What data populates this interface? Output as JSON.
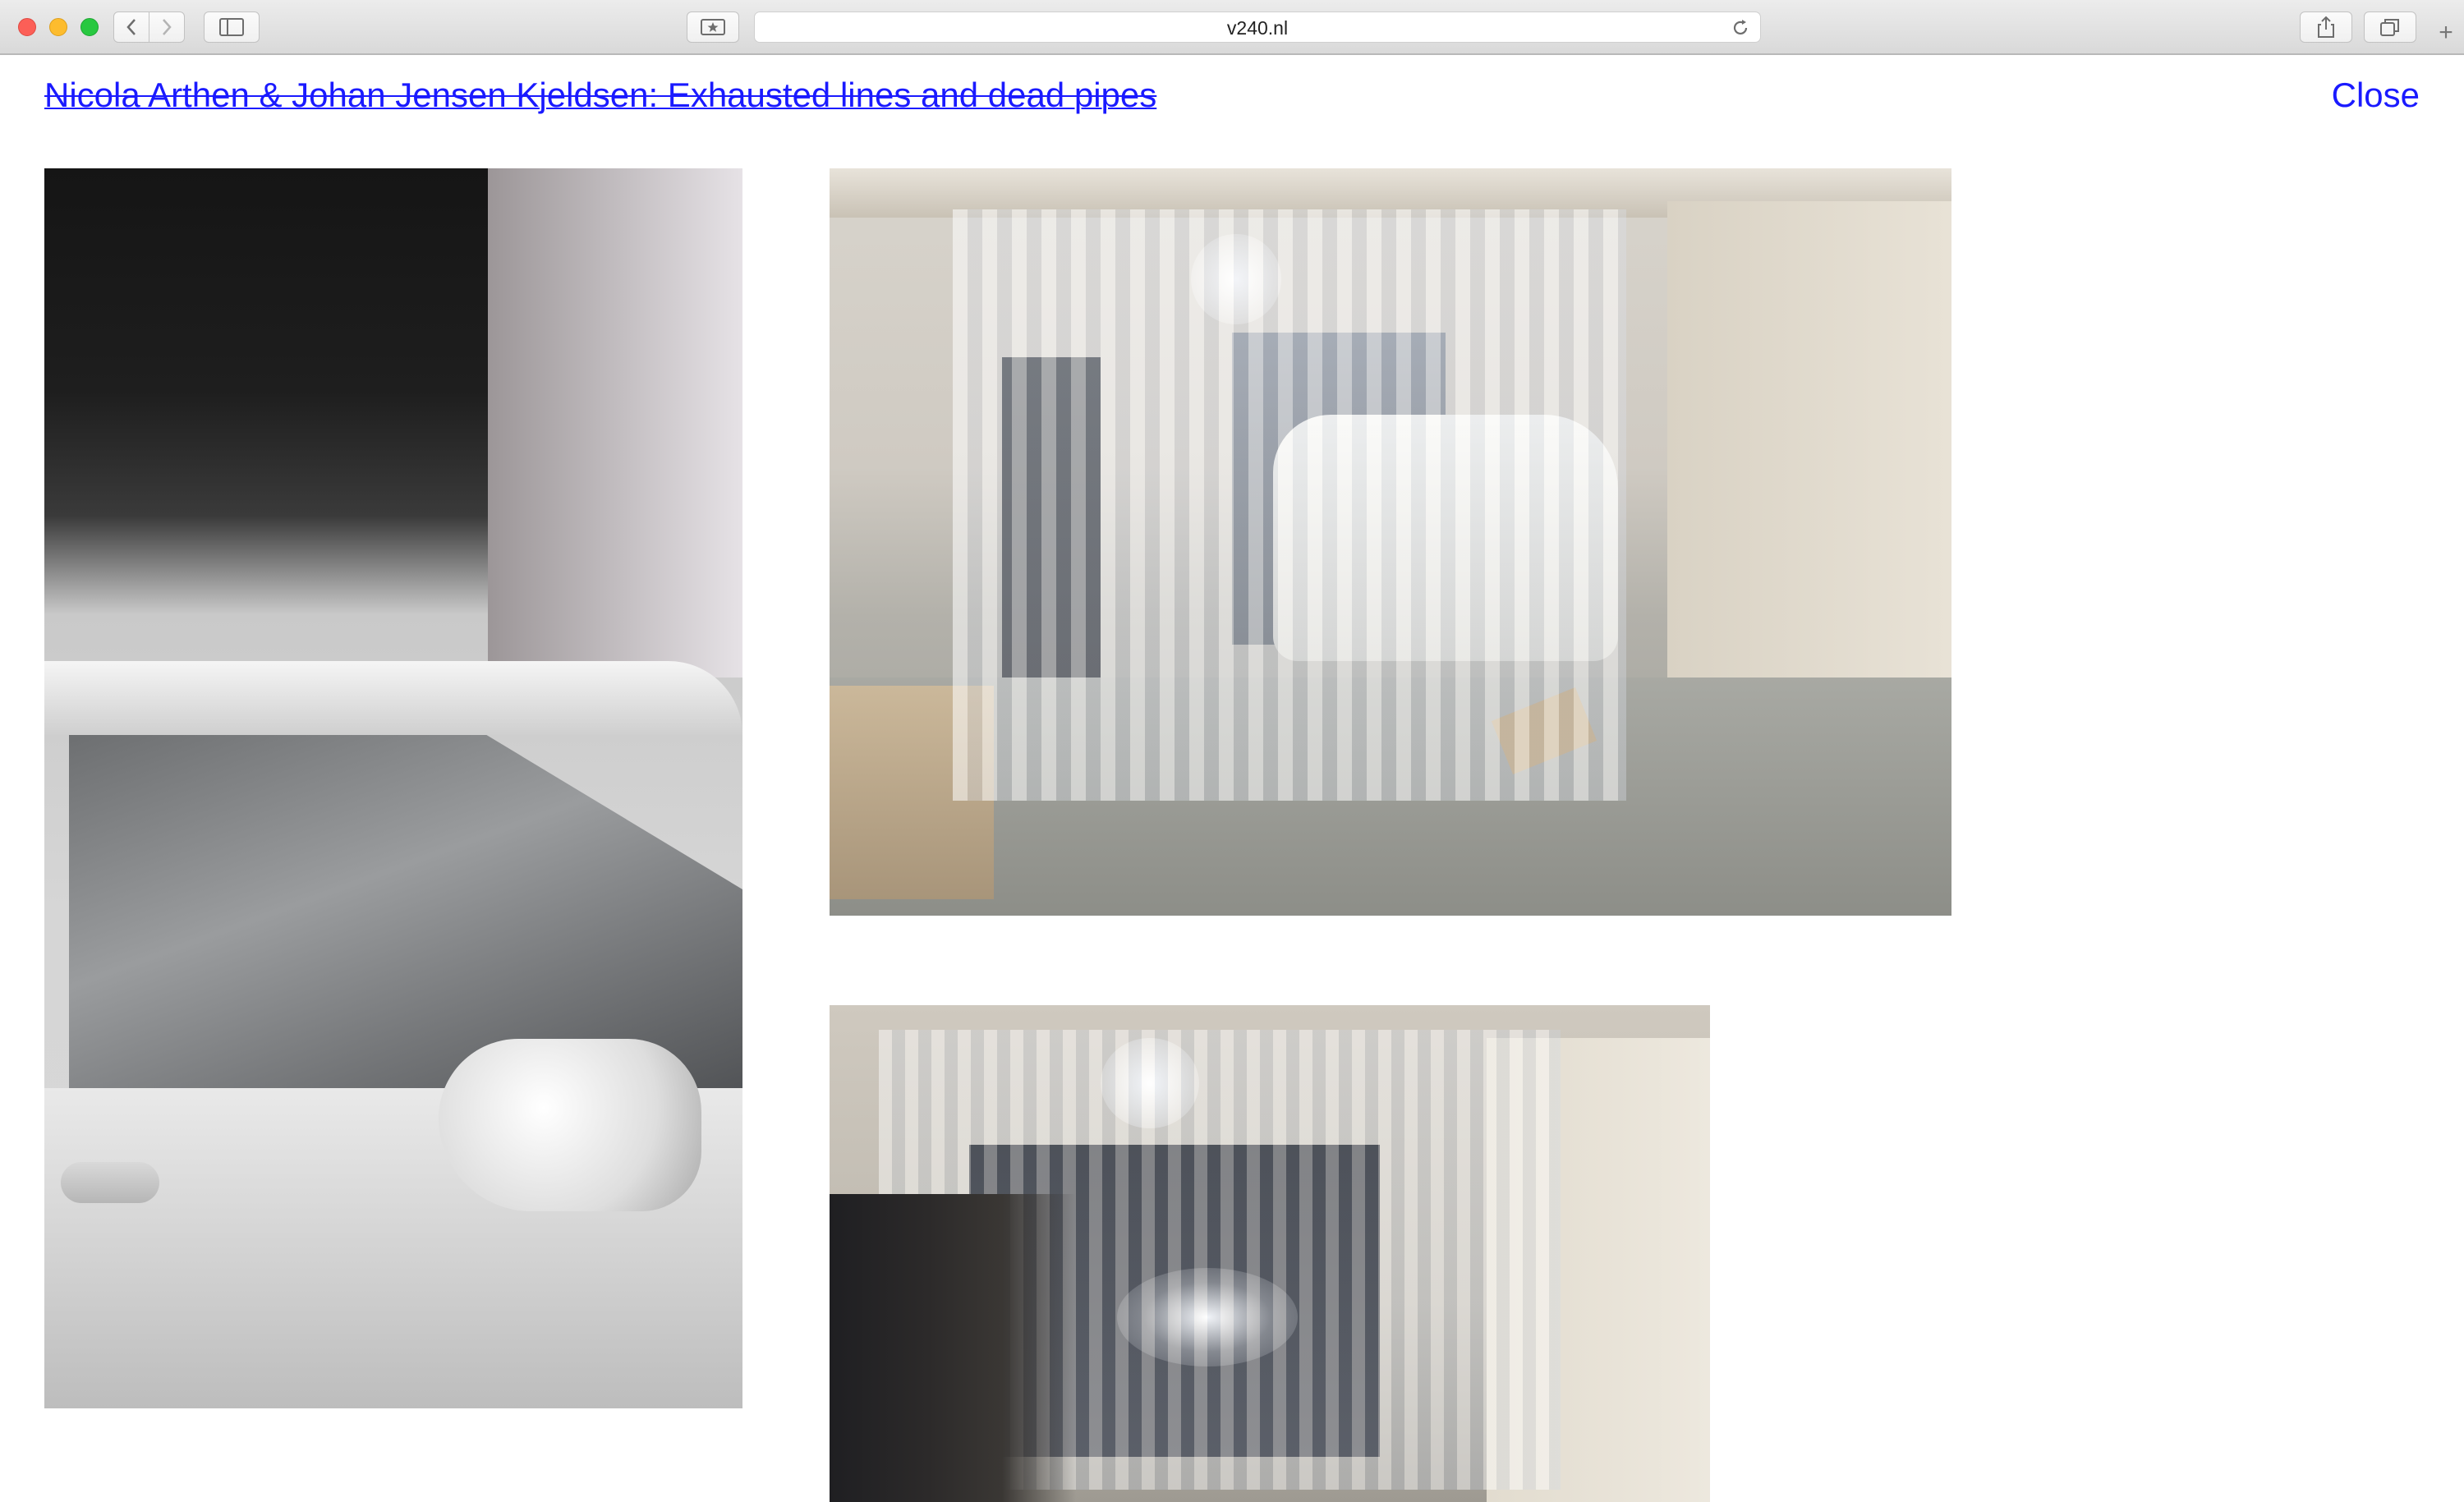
{
  "browser": {
    "url": "v240.nl",
    "icons": {
      "back": "chevron-left-icon",
      "forward": "chevron-right-icon",
      "sidebar": "sidebar-icon",
      "bookmark": "bookmark-star-icon",
      "reload": "reload-icon",
      "share": "share-icon",
      "tabs": "tabs-overview-icon",
      "new_tab": "plus-icon"
    }
  },
  "page": {
    "title": "Nicola Arthen & Johan Jensen Kjeldsen: Exhausted lines and dead pipes",
    "close_label": "Close",
    "link_color": "#1a1aff"
  },
  "gallery": {
    "images": [
      "photo-car-closeup",
      "photo-garage-day",
      "photo-garage-night"
    ]
  }
}
